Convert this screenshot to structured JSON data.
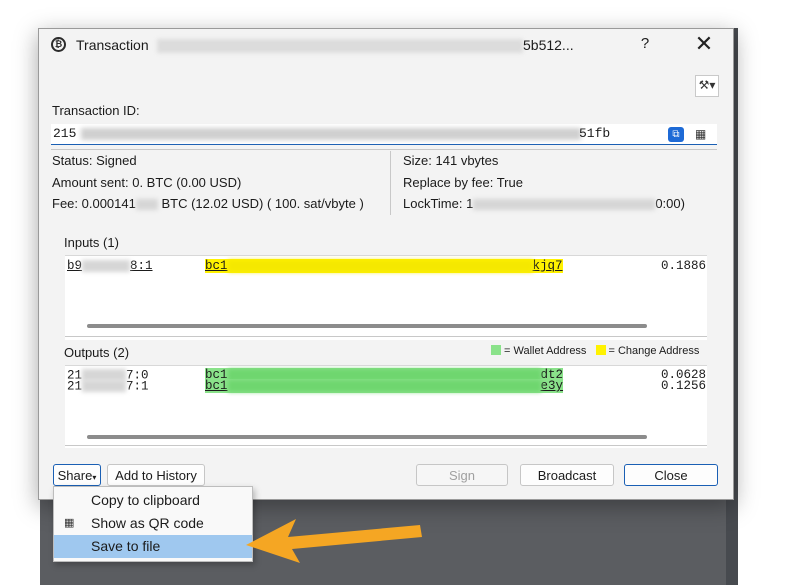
{
  "window": {
    "title_prefix": "Transaction",
    "title_suffix": "5b512...",
    "help_label": "?",
    "close_glyph": "✕"
  },
  "toolbar": {
    "tools_icon": "tools-icon"
  },
  "transaction_id": {
    "label": "Transaction ID:",
    "value_start": "215",
    "value_end": "51fb"
  },
  "details": {
    "status": "Status: Signed",
    "amount_sent": "Amount sent: 0. BTC (0.00 USD)",
    "fee_prefix": "Fee: 0.000141",
    "fee_suffix": "BTC (12.02 USD)  ( 100. sat/vbyte )",
    "size": "Size: 141 vbytes",
    "replace_by_fee": "Replace by fee: True",
    "locktime_prefix": "LockTime: 1",
    "locktime_suffix": "0:00)"
  },
  "inputs": {
    "header": "Inputs (1)",
    "rows": [
      {
        "outpoint_start": "b9",
        "outpoint_end": "8:1",
        "address_start": "bc1",
        "address_end": "kjq7",
        "amount": "0.1886"
      }
    ]
  },
  "outputs": {
    "header": "Outputs (2)",
    "legend_wallet": "= Wallet Address",
    "legend_change": "= Change Address",
    "rows": [
      {
        "outpoint_start": "21",
        "outpoint_end": "7:0",
        "address_start": "bc1",
        "address_end": "dt2",
        "amount": "0.0628"
      },
      {
        "outpoint_start": "21",
        "outpoint_end": "7:1",
        "address_start": "bc1",
        "address_end": "e3y",
        "amount": "0.1256"
      }
    ]
  },
  "buttons": {
    "share": "Share",
    "add_to_history": "Add to History",
    "sign": "Sign",
    "broadcast": "Broadcast",
    "close": "Close"
  },
  "share_menu": {
    "items": [
      "Copy to clipboard",
      "Show as QR code",
      "Save to file"
    ],
    "selected": "Save to file"
  },
  "colors": {
    "wallet_address": "#8ae28a",
    "change_address": "#fff200",
    "selection": "#9fc8ef",
    "accent": "#1a5fb4",
    "arrow": "#f5a623"
  }
}
